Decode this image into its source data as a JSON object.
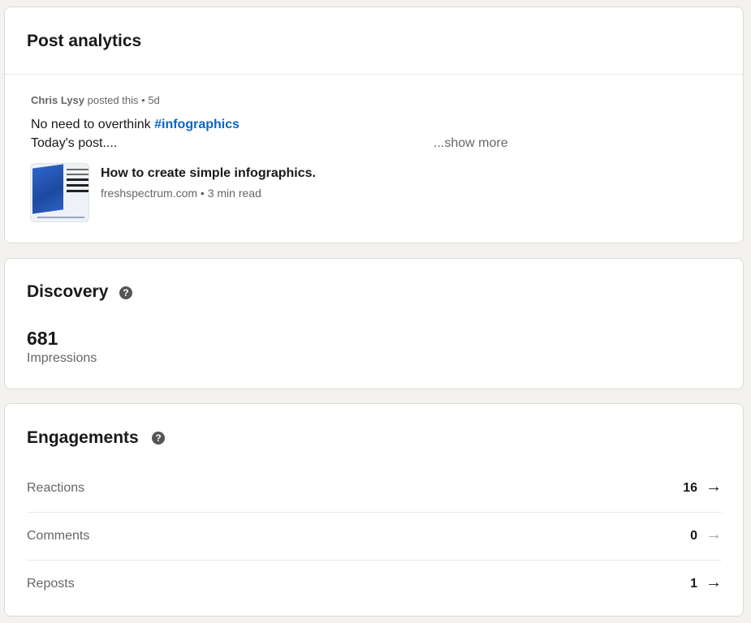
{
  "analytics": {
    "title": "Post analytics",
    "author": "Chris Lysy",
    "posted_text": "posted this",
    "separator": "•",
    "age": "5d",
    "text_prefix": "No need to overthink ",
    "hashtag": "#infographics",
    "text_line2": "Today's post....",
    "show_more": "...show more",
    "link_title": "How to create simple infographics.",
    "link_domain": "freshspectrum.com",
    "link_read_time": "3 min read",
    "link_source_line": "freshspectrum.com • 3 min read"
  },
  "discovery": {
    "title": "Discovery",
    "help_icon": "help-circle-icon",
    "impressions_value": "681",
    "impressions_label": "Impressions"
  },
  "engagements": {
    "title": "Engagements",
    "help_icon": "help-circle-icon",
    "rows": [
      {
        "label": "Reactions",
        "value": "16",
        "arrow_icon": "arrow-right-icon",
        "arrow_active": true
      },
      {
        "label": "Comments",
        "value": "0",
        "arrow_icon": "arrow-right-icon",
        "arrow_active": false
      },
      {
        "label": "Reposts",
        "value": "1",
        "arrow_icon": "arrow-right-icon",
        "arrow_active": true
      }
    ]
  },
  "colors": {
    "background": "#f3f2ef",
    "card": "#ffffff",
    "hashtag": "#0a66c2",
    "text_primary": "#191919",
    "text_secondary": "#666666",
    "arrow_muted": "#a8a8a8"
  }
}
